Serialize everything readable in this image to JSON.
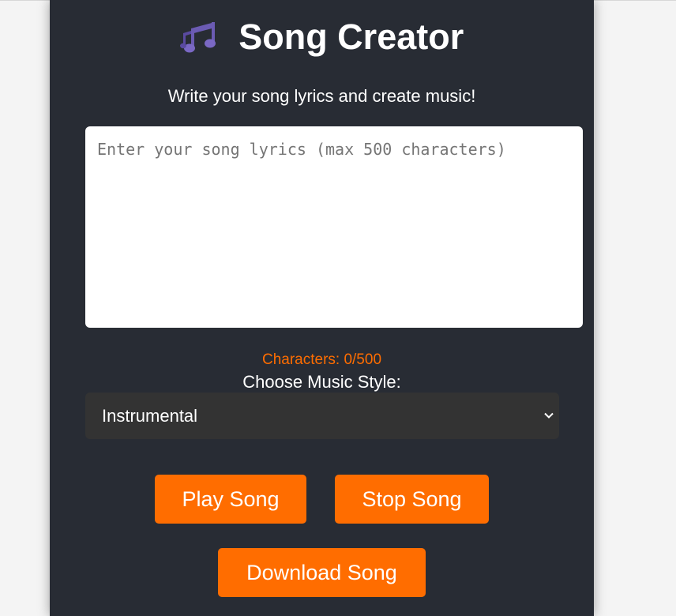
{
  "app": {
    "title": "Song Creator",
    "title_icon": "music-notes-icon",
    "subtitle": "Write your song lyrics and create music!"
  },
  "lyrics": {
    "value": "",
    "placeholder": "Enter your song lyrics (max 500 characters)",
    "max_chars": 500
  },
  "char_counter": {
    "text": "Characters: 0/500"
  },
  "style_selector": {
    "label": "Choose Music Style:",
    "selected": "Instrumental",
    "icon": "chevron-down-icon"
  },
  "buttons": {
    "play": "Play Song",
    "stop": "Stop Song",
    "download": "Download Song"
  },
  "colors": {
    "panel_bg": "#282c34",
    "accent": "#ff6d00",
    "select_bg": "#333333",
    "icon_purple": "#6b5bb3"
  }
}
